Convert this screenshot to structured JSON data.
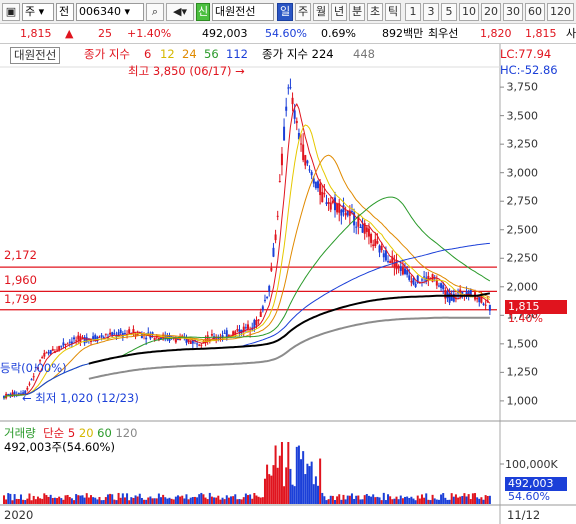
{
  "toolbar": {
    "market": "주",
    "mode": "전",
    "code": "006340",
    "sin_label": "신",
    "stock_name": "대원전선",
    "periods": [
      "일",
      "주",
      "월",
      "년",
      "분",
      "초",
      "틱"
    ],
    "active_period": "일",
    "numbers": [
      "1",
      "3",
      "5",
      "10",
      "20",
      "30",
      "60",
      "120"
    ]
  },
  "quote": {
    "price": "1,815",
    "arrow": "▲",
    "change": "25",
    "change_pct": "+1.40%",
    "volume": "492,003",
    "vol_ratio": "54.60%",
    "turnover": "0.69%",
    "amount": "892백만",
    "low_label": "최우선",
    "bid": "1,820",
    "ask": "1,815",
    "tail": "사"
  },
  "legend": {
    "name": "대원전선",
    "ma_title": "종가 지수",
    "ma_periods": [
      "6",
      "12",
      "24",
      "56",
      "112"
    ],
    "ma2_title": "종가 지수 224",
    "ma2_extra": "448",
    "lc": "LC:77.94",
    "hc": "HC:-52.86"
  },
  "annotations": {
    "high": "최고 3,850 (06/17)",
    "low": "최저 1,020 (12/23)",
    "left_note": "등락(0.00%)"
  },
  "hlines": [
    "2,172",
    "1,960",
    "1,799"
  ],
  "price_axis": [
    "3,750",
    "3,500",
    "3,250",
    "3,000",
    "2,750",
    "2,500",
    "2,250",
    "2,000",
    "1,750",
    "1,500",
    "1,250",
    "1,000"
  ],
  "price_badge": "1,815",
  "pct_badge": "1.40%",
  "volume_panel": {
    "title": "거래량",
    "ma_title": "단순",
    "ma_periods": [
      "5",
      "20",
      "60",
      "120"
    ],
    "value_text": "492,003주(54.60%)",
    "axis_label": "100,000K",
    "badge_value": "492,003",
    "badge_pct": "54.60%"
  },
  "date_axis": {
    "left": "2020",
    "right": "11/12"
  },
  "colors": {
    "up": "#e0141e",
    "down": "#1b3fd8",
    "ma6": "#e0141e",
    "ma12": "#e6c800",
    "ma24": "#e08a00",
    "ma56": "#2a9a2a",
    "ma112": "#1b3fd8",
    "ma224": "#000000",
    "ma448": "#8c8c8c"
  }
}
